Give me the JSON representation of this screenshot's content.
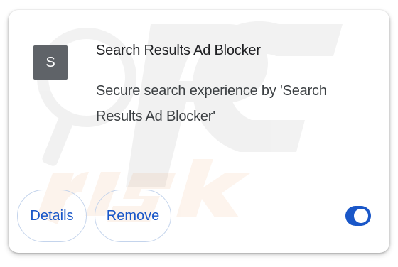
{
  "extension": {
    "icon_letter": "S",
    "icon_color": "#5f6368",
    "name": "Search Results Ad Blocker",
    "description": "Secure search experience by 'Search Results Ad Blocker'"
  },
  "actions": {
    "details_label": "Details",
    "remove_label": "Remove"
  },
  "toggle": {
    "enabled": true,
    "accent_color": "#1a57c8"
  },
  "watermark": {
    "text": "PC risk.com"
  }
}
